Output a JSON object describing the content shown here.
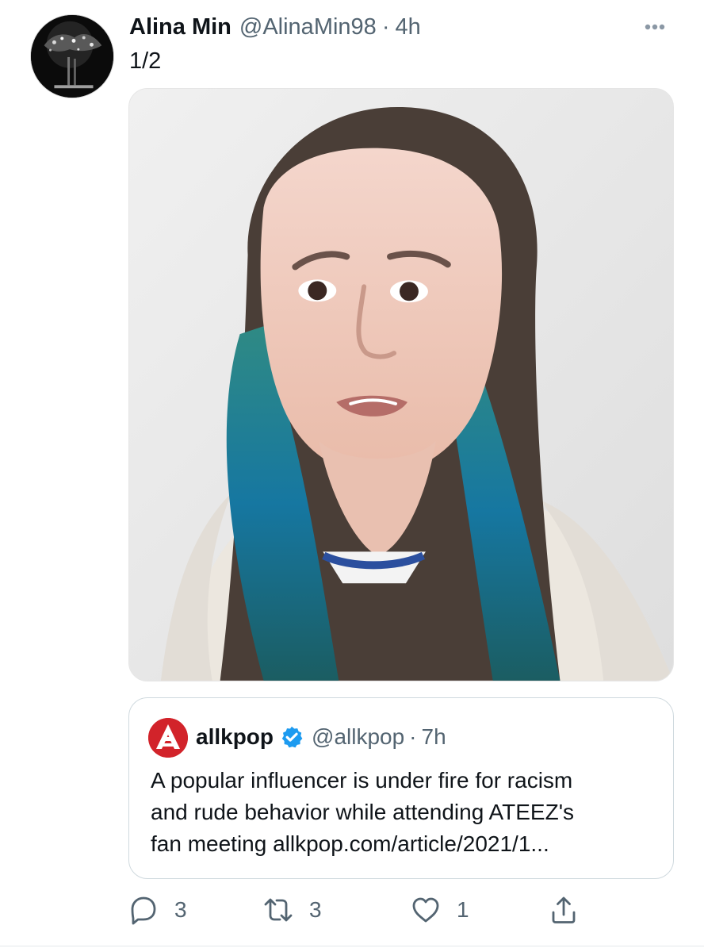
{
  "tweet": {
    "display_name": "Alina Min",
    "handle": "@AlinaMin98",
    "separator": "·",
    "time": "4h",
    "text": "1/2"
  },
  "media": {
    "type": "photo"
  },
  "quote": {
    "name": "allkpop",
    "handle": "@allkpop",
    "separator": "·",
    "time": "7h",
    "text_lines": [
      "A popular influencer is under fire for racism",
      "and rude behavior while attending ATEEZ's",
      "fan meeting allkpop.com/article/2021/1..."
    ]
  },
  "actions": {
    "reply_count": "3",
    "retweet_count": "3",
    "like_count": "1"
  },
  "icons": {
    "more": "more-icon",
    "verified": "verified-badge-icon",
    "reply": "reply-icon",
    "retweet": "retweet-icon",
    "like": "heart-icon",
    "share": "share-icon"
  },
  "colors": {
    "text": "#0f1419",
    "secondary_text": "#536471",
    "verified_blue": "#1d9bf0",
    "allkpop_red": "#d2232a",
    "border": "#cfd9de"
  }
}
